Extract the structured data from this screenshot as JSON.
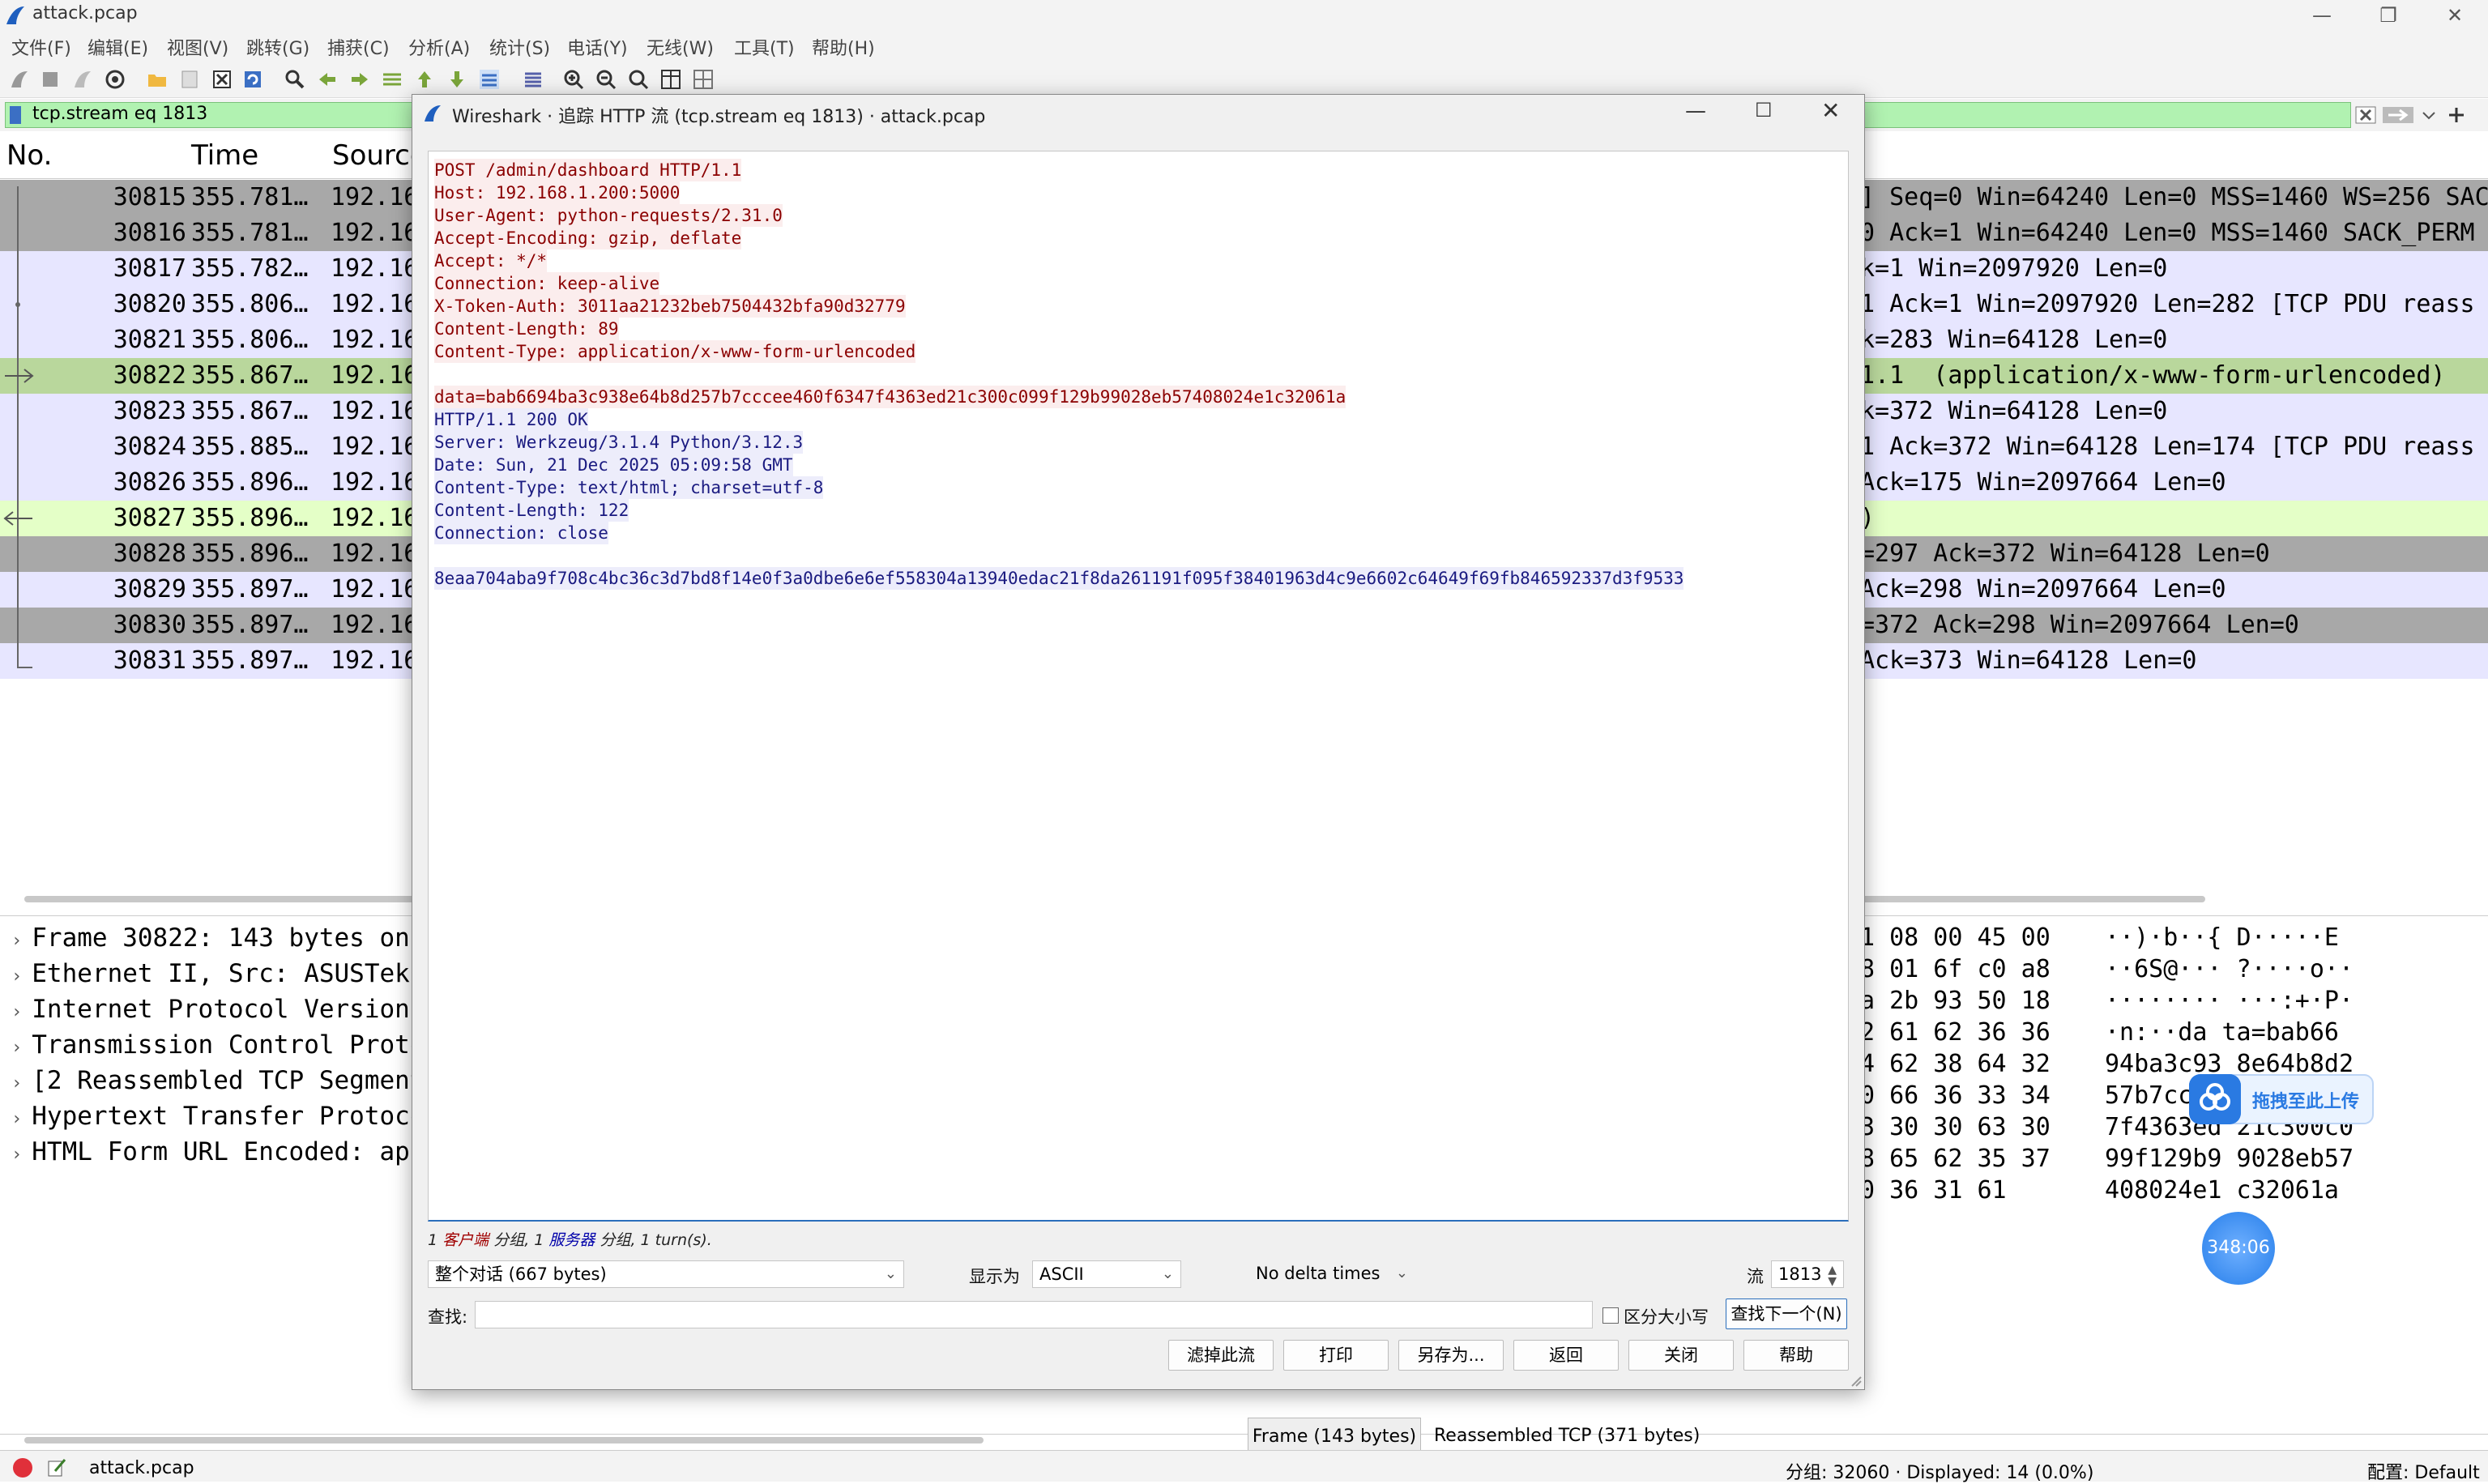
{
  "window": {
    "title": "attack.pcap",
    "controls": [
      "—",
      "❐",
      "✕"
    ]
  },
  "menu": [
    "文件(F)",
    "编辑(E)",
    "视图(V)",
    "跳转(G)",
    "捕获(C)",
    "分析(A)",
    "统计(S)",
    "电话(Y)",
    "无线(W)",
    "工具(T)",
    "帮助(H)"
  ],
  "filter": {
    "value": "tcp.stream eq 1813"
  },
  "columns": {
    "no": "No.",
    "time": "Time",
    "source": "Source"
  },
  "packets": [
    {
      "no": "30815",
      "time": "355.781…",
      "src": "192.16",
      "info": "] Seq=0 Win=64240 Len=0 MSS=1460 WS=256 SAC",
      "bg": "#a8a8a8"
    },
    {
      "no": "30816",
      "time": "355.781…",
      "src": "192.16",
      "info": "0 Ack=1 Win=64240 Len=0 MSS=1460 SACK_PERM",
      "bg": "#a8a8a8"
    },
    {
      "no": "30817",
      "time": "355.782…",
      "src": "192.16",
      "info": "k=1 Win=2097920 Len=0",
      "bg": "#e7e6ff"
    },
    {
      "no": "30820",
      "time": "355.806…",
      "src": "192.16",
      "info": "1 Ack=1 Win=2097920 Len=282 [TCP PDU reass",
      "bg": "#e7e6ff"
    },
    {
      "no": "30821",
      "time": "355.806…",
      "src": "192.16",
      "info": "k=283 Win=64128 Len=0",
      "bg": "#e7e6ff"
    },
    {
      "no": "30822",
      "time": "355.867…",
      "src": "192.16",
      "info": "1.1  (application/x-www-form-urlencoded)",
      "bg": "#b9d79c"
    },
    {
      "no": "30823",
      "time": "355.867…",
      "src": "192.16",
      "info": "k=372 Win=64128 Len=0",
      "bg": "#e7e6ff"
    },
    {
      "no": "30824",
      "time": "355.885…",
      "src": "192.16",
      "info": "1 Ack=372 Win=64128 Len=174 [TCP PDU reass",
      "bg": "#e7e6ff"
    },
    {
      "no": "30826",
      "time": "355.896…",
      "src": "192.16",
      "info": "Ack=175 Win=2097664 Len=0",
      "bg": "#e7e6ff"
    },
    {
      "no": "30827",
      "time": "355.896…",
      "src": "192.16",
      "info": ")",
      "bg": "#e4ffc7"
    },
    {
      "no": "30828",
      "time": "355.896…",
      "src": "192.16",
      "info": "=297 Ack=372 Win=64128 Len=0",
      "bg": "#a8a8a8"
    },
    {
      "no": "30829",
      "time": "355.897…",
      "src": "192.16",
      "info": "Ack=298 Win=2097664 Len=0",
      "bg": "#e7e6ff"
    },
    {
      "no": "30830",
      "time": "355.897…",
      "src": "192.16",
      "info": "=372 Ack=298 Win=2097664 Len=0",
      "bg": "#a8a8a8"
    },
    {
      "no": "30831",
      "time": "355.897…",
      "src": "192.16",
      "info": "Ack=373 Win=64128 Len=0",
      "bg": "#e7e6ff"
    }
  ],
  "details": [
    "Frame 30822: 143 bytes on",
    "Ethernet II, Src: ASUSTekC",
    "Internet Protocol Version",
    "Transmission Control Proto",
    "[2 Reassembled TCP Segment",
    "Hypertext Transfer Protoco",
    "HTML Form URL Encoded: app"
  ],
  "hex": [
    {
      "bytes": "1 08 00 45 00",
      "ascii": "··)·b··{ D·····E"
    },
    {
      "bytes": "8 01 6f c0 a8",
      "ascii": "··6S@··· ?····o··"
    },
    {
      "bytes": "a 2b 93 50 18",
      "ascii": "········ ···:+·P·"
    },
    {
      "bytes": "2 61 62 36 36",
      "ascii": "·n:··da ta=bab66"
    },
    {
      "bytes": "4 62 38 64 32",
      "ascii": "94ba3c93 8e64b8d2"
    },
    {
      "bytes": "0 66 36 33 34",
      "ascii": "57b7cc"
    },
    {
      "bytes": "3 30 30 63 30",
      "ascii": "7f4363ed 21c300c0"
    },
    {
      "bytes": "8 65 62 35 37",
      "ascii": "99f129b9 9028eb57"
    },
    {
      "bytes": "0 36 31 61",
      "ascii": "408024e1 c32061a"
    }
  ],
  "tabs": {
    "frame": "Frame (143 bytes)",
    "reassembled": "Reassembled TCP (371 bytes)"
  },
  "status": {
    "file": "attack.pcap",
    "counts": "分组: 32060 · Displayed: 14 (0.0%)",
    "profile": "配置: Default"
  },
  "dialog": {
    "title": "Wireshark · 追踪 HTTP 流 (tcp.stream eq 1813) · attack.pcap",
    "client_lines": [
      "POST /admin/dashboard HTTP/1.1",
      "Host: 192.168.1.200:5000",
      "User-Agent: python-requests/2.31.0",
      "Accept-Encoding: gzip, deflate",
      "Accept: */*",
      "Connection: keep-alive",
      "X-Token-Auth: 3011aa21232beb7504432bfa90d32779",
      "Content-Length: 89",
      "Content-Type: application/x-www-form-urlencoded",
      "",
      "data=bab6694ba3c938e64b8d257b7cccee460f6347f4363ed21c300c099f129b99028eb57408024e1c32061a"
    ],
    "server_lines": [
      "HTTP/1.1 200 OK",
      "Server: Werkzeug/3.1.4 Python/3.12.3",
      "Date: Sun, 21 Dec 2025 05:09:58 GMT",
      "Content-Type: text/html; charset=utf-8",
      "Content-Length: 122",
      "Connection: close",
      "",
      "8eaa704aba9f708c4bc36c3d7bd8f14e0f3a0dbe6e6ef558304a13940edac21f8da261191f095f38401963d4c9e6602c64649f69fb846592337d3f9533"
    ],
    "turns": {
      "prefix": "1 ",
      "client": "客户端",
      "mid": " 分组, 1 ",
      "server": "服务器",
      "suffix": " 分组, 1 turn(s)."
    },
    "conversation": "整个对话 (667 bytes)",
    "show_as_label": "显示为",
    "show_as": "ASCII",
    "delta": "No delta times",
    "stream_label": "流",
    "stream_value": "1813",
    "find_label": "查找:",
    "case_label": "区分大小写",
    "find_next": "查找下一个(N)",
    "buttons": [
      "滤掉此流",
      "打印",
      "另存为...",
      "返回",
      "关闭",
      "帮助"
    ]
  },
  "overlay": {
    "upload": "拖拽至此上传",
    "timer": "348:06"
  },
  "colors": {
    "filter_ok": "#b1f2b1",
    "client_text": "#8b0000",
    "server_text": "#1a1a80",
    "accent": "#2a6ebb"
  }
}
